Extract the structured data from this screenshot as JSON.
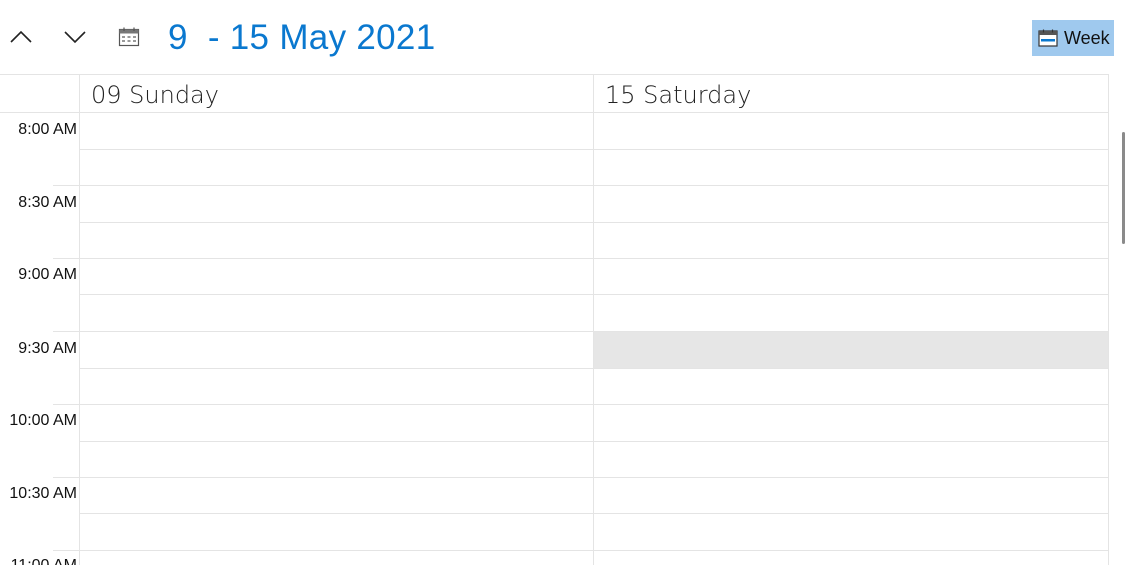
{
  "header": {
    "date_range": "9  - 15 May 2021",
    "view_label": "Week",
    "icons": {
      "prev": "chevron-up-icon",
      "next": "chevron-down-icon",
      "calendar": "calendar-icon",
      "view": "calendar-week-icon"
    }
  },
  "columns": [
    {
      "label": "09 Sunday"
    },
    {
      "label": "15 Saturday"
    }
  ],
  "times": [
    "8:00 AM",
    "8:30 AM",
    "9:00 AM",
    "9:30 AM",
    "10:00 AM",
    "10:30 AM",
    "11:00 AM"
  ],
  "colors": {
    "accent": "#0a78cf",
    "view_button_bg": "#9fc9ee",
    "selected_cell": "#e6e6e6",
    "grid_line": "#e4e4e4"
  },
  "selected_slot": {
    "column": "15 Saturday",
    "time": "9:30 AM"
  }
}
